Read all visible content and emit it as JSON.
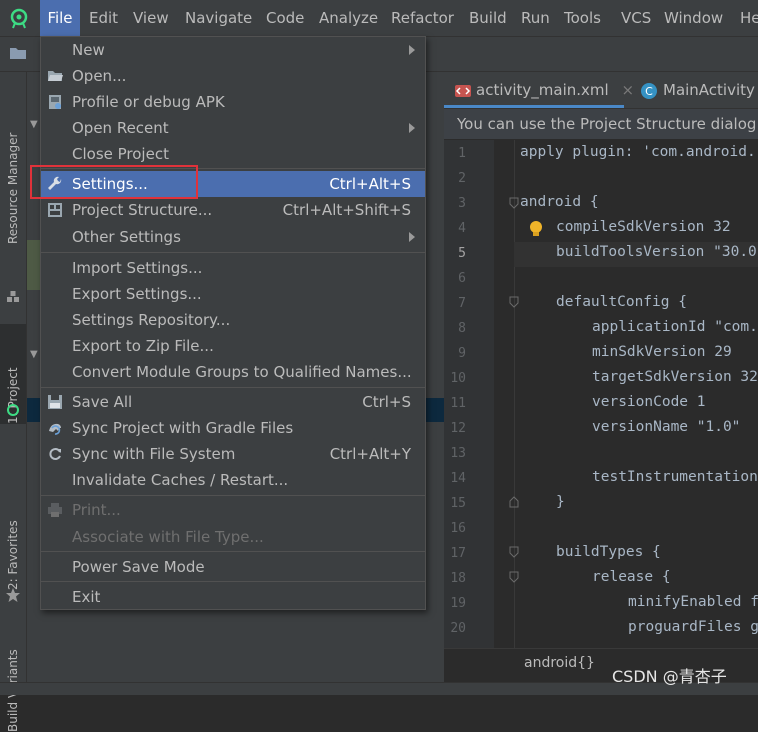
{
  "menubar": {
    "items": [
      "File",
      "Edit",
      "View",
      "Navigate",
      "Code",
      "Analyze",
      "Refactor",
      "Build",
      "Run",
      "Tools",
      "VCS",
      "Window",
      "He"
    ]
  },
  "left_strip": {
    "tabs": [
      "Resource Manager",
      "1: Project",
      "2: Favorites",
      "Build Variants"
    ]
  },
  "editor": {
    "tabs": [
      "activity_main.xml",
      "MainActivity"
    ],
    "banner": "You can use the Project Structure dialog t",
    "line_numbers": [
      "1",
      "2",
      "3",
      "4",
      "5",
      "6",
      "7",
      "8",
      "9",
      "10",
      "11",
      "12",
      "13",
      "14",
      "15",
      "16",
      "17",
      "18",
      "19",
      "20"
    ],
    "lines": [
      {
        "n": "1",
        "text": "apply plugin: 'com.android."
      },
      {
        "n": "3",
        "text": "android {"
      },
      {
        "n": "4",
        "text": "compileSdkVersion 32"
      },
      {
        "n": "5",
        "text": "buildToolsVersion \"30.0"
      },
      {
        "n": "7",
        "text": "defaultConfig {"
      },
      {
        "n": "8",
        "text": "applicationId \"com."
      },
      {
        "n": "9",
        "text": "minSdkVersion 29"
      },
      {
        "n": "10",
        "text": "targetSdkVersion 32"
      },
      {
        "n": "11",
        "text": "versionCode 1"
      },
      {
        "n": "12",
        "text": "versionName \"1.0\""
      },
      {
        "n": "14",
        "text": "testInstrumentation"
      },
      {
        "n": "15",
        "text": "}"
      },
      {
        "n": "17",
        "text": "buildTypes {"
      },
      {
        "n": "18",
        "text": "release {"
      },
      {
        "n": "19",
        "text": "minifyEnabled f"
      },
      {
        "n": "20",
        "text": "proguardFiles g"
      }
    ],
    "breadcrumb": "android{}"
  },
  "file_menu": {
    "items": [
      {
        "label": "New",
        "shortcut": "",
        "submenu": true
      },
      {
        "label": "Open...",
        "shortcut": "",
        "icon": "folder-open-icon"
      },
      {
        "label": "Profile or debug APK",
        "shortcut": "",
        "icon": "apk-icon"
      },
      {
        "label": "Open Recent",
        "shortcut": "",
        "submenu": true
      },
      {
        "label": "Close Project",
        "shortcut": ""
      },
      {
        "label": "Settings...",
        "shortcut": "Ctrl+Alt+S",
        "icon": "wrench-icon",
        "selected": true
      },
      {
        "label": "Project Structure...",
        "shortcut": "Ctrl+Alt+Shift+S",
        "icon": "project-structure-icon"
      },
      {
        "label": "Other Settings",
        "shortcut": "",
        "submenu": true
      },
      {
        "label": "Import Settings...",
        "shortcut": ""
      },
      {
        "label": "Export Settings...",
        "shortcut": ""
      },
      {
        "label": "Settings Repository...",
        "shortcut": ""
      },
      {
        "label": "Export to Zip File...",
        "shortcut": ""
      },
      {
        "label": "Convert Module Groups to Qualified Names...",
        "shortcut": ""
      },
      {
        "label": "Save All",
        "shortcut": "Ctrl+S",
        "icon": "save-icon"
      },
      {
        "label": "Sync Project with Gradle Files",
        "shortcut": "",
        "icon": "gradle-sync-icon"
      },
      {
        "label": "Sync with File System",
        "shortcut": "Ctrl+Alt+Y",
        "icon": "refresh-icon"
      },
      {
        "label": "Invalidate Caches / Restart...",
        "shortcut": ""
      },
      {
        "label": "Print...",
        "shortcut": "",
        "icon": "print-icon",
        "disabled": true
      },
      {
        "label": "Associate with File Type...",
        "shortcut": "",
        "disabled": true
      },
      {
        "label": "Power Save Mode",
        "shortcut": ""
      },
      {
        "label": "Exit",
        "shortcut": ""
      }
    ]
  },
  "watermark": "CSDN @青杏子",
  "colors": {
    "accent": "#4b6eaf",
    "highlight_box": "#e0323a",
    "background": "#2b2b2b",
    "panel": "#3c3f41"
  }
}
